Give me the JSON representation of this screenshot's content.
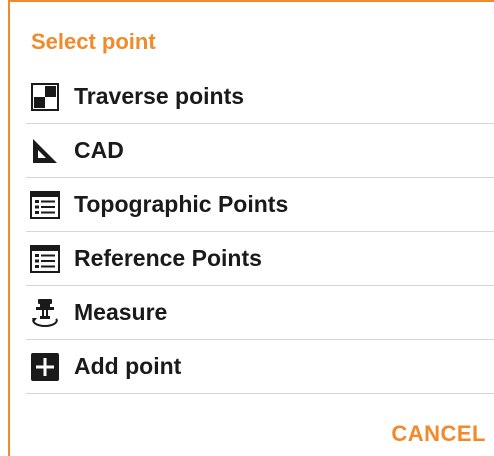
{
  "colors": {
    "accent": "#f08a2a",
    "text": "#1a1a1a",
    "divider": "#d6d6d6",
    "background": "#ffffff"
  },
  "dialog": {
    "title": "Select point",
    "items": [
      {
        "label": "Traverse points",
        "icon": "traverse-points-icon"
      },
      {
        "label": "CAD",
        "icon": "set-square-icon"
      },
      {
        "label": "Topographic Points",
        "icon": "point-list-icon"
      },
      {
        "label": "Reference Points",
        "icon": "point-list-icon"
      },
      {
        "label": "Measure",
        "icon": "survey-instrument-icon"
      },
      {
        "label": "Add point",
        "icon": "plus-box-icon"
      }
    ],
    "cancel_label": "CANCEL"
  }
}
